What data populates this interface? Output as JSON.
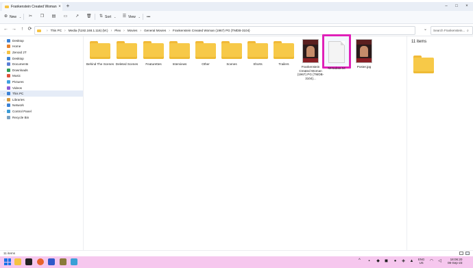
{
  "window": {
    "tab_title": "Frankenstein Created Woman",
    "tab_close": "×",
    "new_tab": "+",
    "controls": [
      "–",
      "□",
      "×"
    ]
  },
  "toolbar": {
    "new_label": "New",
    "sort_label": "Sort",
    "view_label": "View",
    "more_label": "•••"
  },
  "address": {
    "crumbs": [
      "This PC",
      "Media (\\\\192.168.1.116) (M:)",
      "Plex",
      "Movies",
      "General Movies",
      "Frankenstein Created Woman (1967) PG {TMDB-3104}"
    ],
    "search_placeholder": "Search Frankenstein..."
  },
  "sidebar": {
    "items": [
      {
        "label": "Desktop",
        "icon": "desktop-icon",
        "color": "#3b82d6"
      },
      {
        "label": "Home",
        "icon": "home-icon",
        "color": "#e8812b"
      },
      {
        "label": "Zenoid 2T",
        "icon": "folder-icon",
        "color": "#f5c242"
      },
      {
        "label": "Desktop",
        "icon": "desktop-icon",
        "color": "#3b82d6"
      },
      {
        "label": "Documents",
        "icon": "documents-icon",
        "color": "#5a7fd6"
      },
      {
        "label": "Downloads",
        "icon": "downloads-icon",
        "color": "#2e9e58"
      },
      {
        "label": "Music",
        "icon": "music-icon",
        "color": "#e0523b"
      },
      {
        "label": "Pictures",
        "icon": "pictures-icon",
        "color": "#3fa0e0"
      },
      {
        "label": "Videos",
        "icon": "videos-icon",
        "color": "#8a5cd6"
      },
      {
        "label": "This PC",
        "icon": "pc-icon",
        "color": "#3b82d6"
      },
      {
        "label": "Libraries",
        "icon": "libraries-icon",
        "color": "#d69a3b"
      },
      {
        "label": "Network",
        "icon": "network-icon",
        "color": "#3b82d6"
      },
      {
        "label": "Control Panel",
        "icon": "control-panel-icon",
        "color": "#3b9bd6"
      },
      {
        "label": "Recycle Bin",
        "icon": "recycle-bin-icon",
        "color": "#7aa0c0"
      }
    ],
    "selected": "This PC"
  },
  "content": {
    "items": [
      {
        "label": "Behind The Scenes",
        "type": "folder"
      },
      {
        "label": "Deleted Scenes",
        "type": "folder"
      },
      {
        "label": "Featurettes",
        "type": "folder"
      },
      {
        "label": "Interviews",
        "type": "folder"
      },
      {
        "label": "Other",
        "type": "folder"
      },
      {
        "label": "Scenes",
        "type": "folder"
      },
      {
        "label": "Shorts",
        "type": "folder"
      },
      {
        "label": "Trailers",
        "type": "folder"
      },
      {
        "label": "Frankenstein Created Woman (1967) PG {TMDB-3104}...",
        "type": "video"
      },
      {
        "label": "Metadata.txt",
        "type": "text"
      },
      {
        "label": "Poster.jpg",
        "type": "image"
      }
    ],
    "highlighted": "Metadata.txt"
  },
  "details": {
    "count_label": "11 items"
  },
  "status": {
    "count_label": "11 items"
  },
  "taskbar": {
    "apps": [
      "start",
      "explorer",
      "terminal",
      "firefox",
      "vpn",
      "app",
      "photos"
    ],
    "lang": [
      "ENG",
      "US"
    ],
    "time": "18:06:20",
    "date": "08-Sep-23"
  },
  "colors": {
    "highlight": "#e020b8",
    "taskbar": "#f6c7ee",
    "folder": "#f7c948"
  }
}
